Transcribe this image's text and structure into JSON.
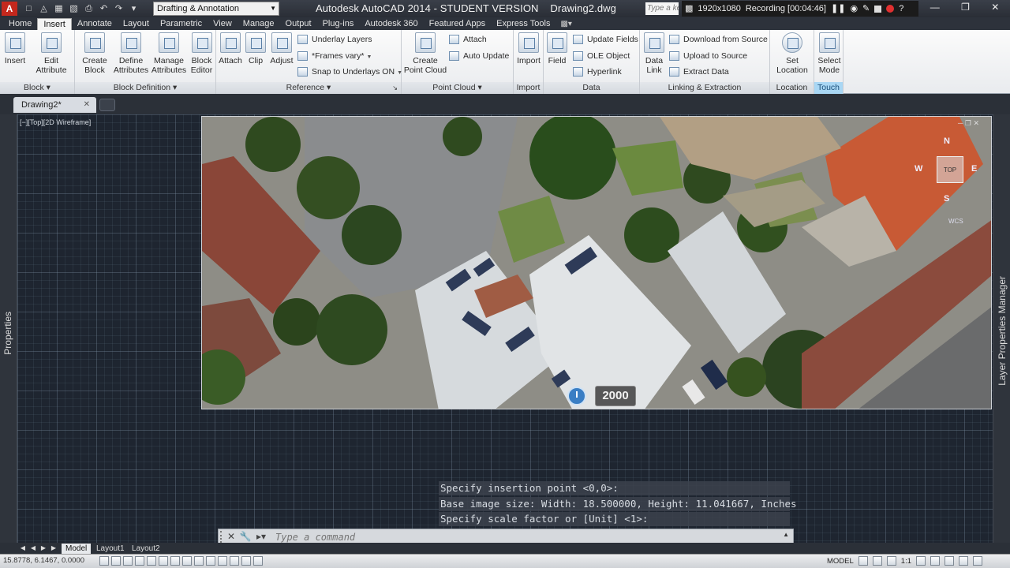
{
  "app": {
    "icon_letter": "A",
    "title": "Autodesk AutoCAD 2014 - STUDENT VERSION    Drawing2.dwg",
    "workspace": "Drafting & Annotation",
    "search_placeholder": "Type a keyword",
    "recording": {
      "resolution": "1920x1080",
      "status": "Recording [00:04:46]"
    }
  },
  "ribbon_tabs": [
    "Home",
    "Insert",
    "Annotate",
    "Layout",
    "Parametric",
    "View",
    "Manage",
    "Output",
    "Plug-ins",
    "Autodesk 360",
    "Featured Apps",
    "Express Tools"
  ],
  "active_tab": "Insert",
  "panels": {
    "block": {
      "title": "Block",
      "insert": "Insert",
      "edit_attribute_1": "Edit",
      "edit_attribute_2": "Attribute"
    },
    "block_definition": {
      "title": "Block Definition",
      "create_1": "Create",
      "create_2": "Block",
      "define_1": "Define",
      "define_2": "Attributes",
      "manage_1": "Manage",
      "manage_2": "Attributes",
      "editor_1": "Block",
      "editor_2": "Editor"
    },
    "reference": {
      "title": "Reference",
      "attach": "Attach",
      "clip": "Clip",
      "adjust": "Adjust",
      "underlay_layers": "Underlay Layers",
      "frames_vary": "*Frames vary*",
      "snap_underlays": "Snap to Underlays ON"
    },
    "point_cloud": {
      "title": "Point Cloud",
      "create_1": "Create",
      "create_2": "Point Cloud",
      "attach": "Attach",
      "auto_update": "Auto Update"
    },
    "import": {
      "title": "Import",
      "import": "Import"
    },
    "data": {
      "title": "Data",
      "field": "Field",
      "update_fields": "Update Fields",
      "ole_object": "OLE Object",
      "hyperlink": "Hyperlink"
    },
    "linking": {
      "title": "Linking & Extraction",
      "data_link_1": "Data",
      "data_link_2": "Link",
      "download": "Download from Source",
      "upload": "Upload to Source",
      "extract": "Extract  Data"
    },
    "location": {
      "title": "Location",
      "set_1": "Set",
      "set_2": "Location"
    },
    "touch": {
      "title": "Touch",
      "select_1": "Select",
      "select_2": "Mode"
    }
  },
  "doc_tab": "Drawing2*",
  "viewport_label": "[−][Top][2D Wireframe]",
  "left_palette": "Properties",
  "right_palette": "Layer Properties Manager",
  "aerial": {
    "time_badge": "2000",
    "viewcube_face": "TOP",
    "n": "N",
    "w": "W",
    "e": "E",
    "s": "S",
    "wcs": "WCS"
  },
  "command_history": [
    "Specify insertion point <0,0>:",
    "Base image size: Width: 18.500000, Height: 11.041667, Inches",
    "Specify scale factor or [Unit] <1>:"
  ],
  "command_placeholder": "Type a command",
  "layout_tabs": [
    "Model",
    "Layout1",
    "Layout2"
  ],
  "status": {
    "coords": "15.8778, 6.1467, 0.0000",
    "space": "MODEL",
    "scale": "1:1"
  }
}
